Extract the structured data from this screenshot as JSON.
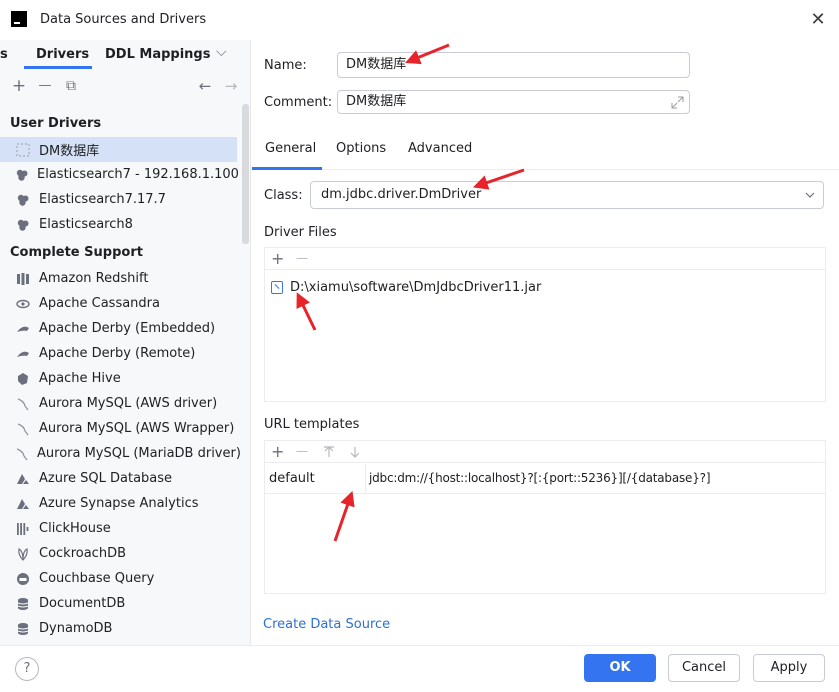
{
  "window": {
    "title": "Data Sources and Drivers",
    "close_glyph": "✕"
  },
  "left": {
    "tabs": {
      "cut_tab": "s",
      "drivers": "Drivers",
      "ddl": "DDL Mappings",
      "more_glyph": "⌵"
    },
    "toolbar": {
      "add": "+",
      "remove": "—",
      "copy": "⧉",
      "back": "←",
      "forward": "→"
    },
    "groups": {
      "user": "User Drivers",
      "complete": "Complete Support"
    },
    "user_items": [
      {
        "label": "DM数据库",
        "icon": "dm-driver-icon"
      },
      {
        "label": "Elasticsearch7 - 192.168.1.100",
        "icon": "elasticsearch-icon"
      },
      {
        "label": "Elasticsearch7.17.7",
        "icon": "elasticsearch-icon"
      },
      {
        "label": "Elasticsearch8",
        "icon": "elasticsearch-icon"
      }
    ],
    "complete_items": [
      {
        "label": "Amazon Redshift",
        "icon": "redshift-icon"
      },
      {
        "label": "Apache Cassandra",
        "icon": "cassandra-icon"
      },
      {
        "label": "Apache Derby (Embedded)",
        "icon": "derby-icon"
      },
      {
        "label": "Apache Derby (Remote)",
        "icon": "derby-icon"
      },
      {
        "label": "Apache Hive",
        "icon": "hive-icon"
      },
      {
        "label": "Aurora MySQL (AWS driver)",
        "icon": "mysql-icon"
      },
      {
        "label": "Aurora MySQL (AWS Wrapper)",
        "icon": "mysql-icon"
      },
      {
        "label": "Aurora MySQL (MariaDB driver)",
        "icon": "mysql-icon"
      },
      {
        "label": "Azure SQL Database",
        "icon": "azure-icon"
      },
      {
        "label": "Azure Synapse Analytics",
        "icon": "azure-icon"
      },
      {
        "label": "ClickHouse",
        "icon": "clickhouse-icon"
      },
      {
        "label": "CockroachDB",
        "icon": "cockroach-icon"
      },
      {
        "label": "Couchbase Query",
        "icon": "couchbase-icon"
      },
      {
        "label": "DocumentDB",
        "icon": "documentdb-icon"
      },
      {
        "label": "DynamoDB",
        "icon": "dynamodb-icon"
      }
    ]
  },
  "form": {
    "name_label": "Name:",
    "name_value": "DM数据库",
    "comment_label": "Comment:",
    "comment_value": "DM数据库",
    "tabs": {
      "general": "General",
      "options": "Options",
      "advanced": "Advanced"
    },
    "class_label": "Class:",
    "class_value": "dm.jdbc.driver.DmDriver",
    "driver_files_label": "Driver Files",
    "driver_file": "D:\\xiamu\\software\\DmJdbcDriver11.jar",
    "url_templates_label": "URL templates",
    "url_template_name": "default",
    "url_template_value": "jdbc:dm://{host::localhost}?[:{port::5236}][/{database}?]",
    "create_link": "Create Data Source"
  },
  "footer": {
    "help": "?",
    "ok": "OK",
    "cancel": "Cancel",
    "apply": "Apply"
  },
  "colors": {
    "accent": "#3574f0",
    "annotation": "#e8242b"
  }
}
